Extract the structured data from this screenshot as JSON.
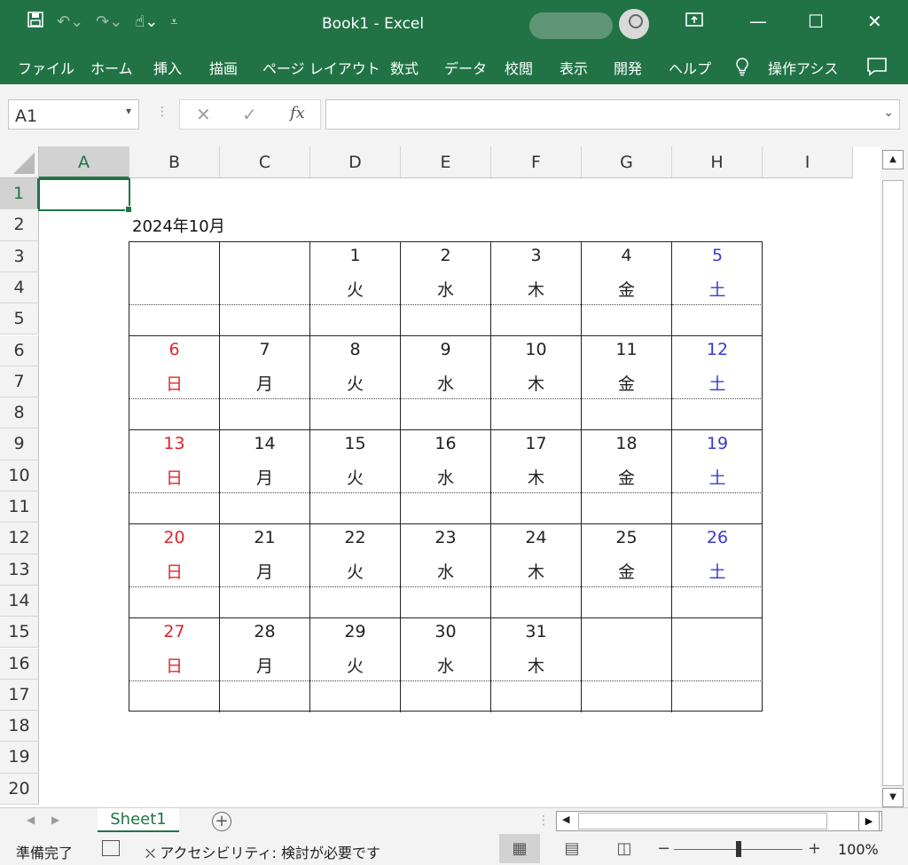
{
  "window": {
    "title": "Book1  -  Excel"
  },
  "ribbon_tabs": [
    "ファイル",
    "ホーム",
    "挿入",
    "描画",
    "ページ レイアウト",
    "数式",
    "データ",
    "校閲",
    "表示",
    "開発",
    "ヘルプ",
    "操作アシス"
  ],
  "formula_bar": {
    "name_box": "A1",
    "formula": ""
  },
  "columns": [
    "A",
    "B",
    "C",
    "D",
    "E",
    "F",
    "G",
    "H",
    "I"
  ],
  "rows": [
    "1",
    "2",
    "3",
    "4",
    "5",
    "6",
    "7",
    "8",
    "9",
    "10",
    "11",
    "12",
    "13",
    "14",
    "15",
    "16",
    "17",
    "18",
    "19",
    "20"
  ],
  "calendar": {
    "title": "2024年10月",
    "weeks": [
      [
        {
          "n": "",
          "d": ""
        },
        {
          "n": "",
          "d": ""
        },
        {
          "n": "1",
          "d": "火"
        },
        {
          "n": "2",
          "d": "水"
        },
        {
          "n": "3",
          "d": "木"
        },
        {
          "n": "4",
          "d": "金"
        },
        {
          "n": "5",
          "d": "土"
        }
      ],
      [
        {
          "n": "6",
          "d": "日"
        },
        {
          "n": "7",
          "d": "月"
        },
        {
          "n": "8",
          "d": "火"
        },
        {
          "n": "9",
          "d": "水"
        },
        {
          "n": "10",
          "d": "木"
        },
        {
          "n": "11",
          "d": "金"
        },
        {
          "n": "12",
          "d": "土"
        }
      ],
      [
        {
          "n": "13",
          "d": "日"
        },
        {
          "n": "14",
          "d": "月"
        },
        {
          "n": "15",
          "d": "火"
        },
        {
          "n": "16",
          "d": "水"
        },
        {
          "n": "17",
          "d": "木"
        },
        {
          "n": "18",
          "d": "金"
        },
        {
          "n": "19",
          "d": "土"
        }
      ],
      [
        {
          "n": "20",
          "d": "日"
        },
        {
          "n": "21",
          "d": "月"
        },
        {
          "n": "22",
          "d": "火"
        },
        {
          "n": "23",
          "d": "水"
        },
        {
          "n": "24",
          "d": "木"
        },
        {
          "n": "25",
          "d": "金"
        },
        {
          "n": "26",
          "d": "土"
        }
      ],
      [
        {
          "n": "27",
          "d": "日"
        },
        {
          "n": "28",
          "d": "月"
        },
        {
          "n": "29",
          "d": "火"
        },
        {
          "n": "30",
          "d": "水"
        },
        {
          "n": "31",
          "d": "木"
        },
        {
          "n": "",
          "d": ""
        },
        {
          "n": "",
          "d": ""
        }
      ]
    ],
    "colors": {
      "sunday": "#e0262b",
      "saturday": "#3a3ad6"
    }
  },
  "sheets": [
    "Sheet1"
  ],
  "status": {
    "ready": "準備完了",
    "accessibility": "アクセシビリティ: 検討が必要です",
    "zoom": "100%"
  },
  "icons": [
    "save-icon",
    "undo-icon",
    "redo-icon",
    "touch-mode-icon",
    "customize-qat-icon",
    "ribbon-display-icon",
    "minimize-icon",
    "maximize-icon",
    "close-icon",
    "lightbulb-icon",
    "comments-icon",
    "cancel-icon",
    "enter-icon",
    "insert-function-icon",
    "add-sheet-icon",
    "macro-record-icon",
    "accessibility-icon",
    "normal-view-icon",
    "page-layout-view-icon",
    "page-break-view-icon"
  ]
}
